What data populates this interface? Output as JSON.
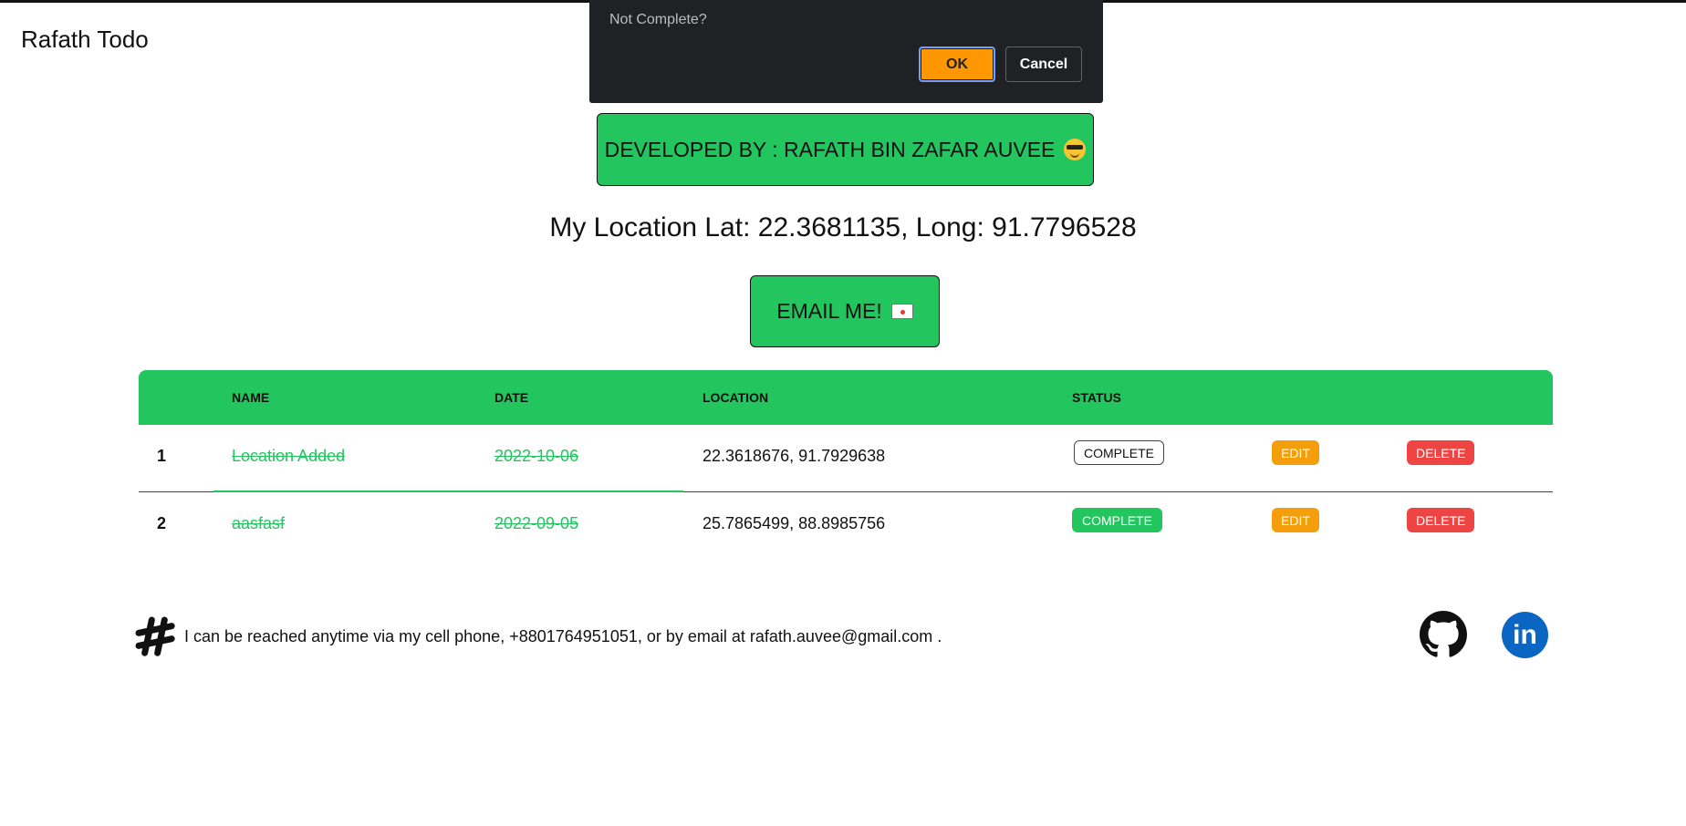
{
  "app": {
    "brand": "Rafath Todo"
  },
  "dialog": {
    "message": "Not Complete?",
    "ok_label": "OK",
    "cancel_label": "Cancel"
  },
  "banner": {
    "text": "DEVELOPED BY : RAFATH BIN ZAFAR AUVEE",
    "emoji_icon": "sunglasses-face-icon"
  },
  "location": {
    "text": "My Location Lat: 22.3681135, Long: 91.7796528"
  },
  "email_button": {
    "label": "EMAIL ME!",
    "icon": "envelope-icon"
  },
  "table": {
    "headers": {
      "index": "",
      "name": "NAME",
      "date": "DATE",
      "location": "LOCATION",
      "status": "STATUS"
    },
    "rows": [
      {
        "index": "1",
        "name": "Location Added",
        "date": "2022-10-06",
        "location": "22.3618676, 91.7929638",
        "status": "COMPLETE",
        "status_style": "outline",
        "edit": "EDIT",
        "delete": "DELETE"
      },
      {
        "index": "2",
        "name": "aasfasf",
        "date": "2022-09-05",
        "location": "25.7865499, 88.8985756",
        "status": "COMPLETE",
        "status_style": "solid",
        "edit": "EDIT",
        "delete": "DELETE"
      }
    ]
  },
  "footer": {
    "contact": "I can be reached anytime via my cell phone, +8801764951051, or by email at rafath.auvee@gmail.com  .",
    "icons": [
      "slack-icon",
      "github-icon",
      "linkedin-icon"
    ],
    "linkedin_text": "in"
  },
  "colors": {
    "accent_green": "#22c55e",
    "edit_orange": "#f59e0b",
    "delete_red": "#ef4444",
    "dialog_bg": "#202124",
    "ok_orange": "#ff9800"
  }
}
